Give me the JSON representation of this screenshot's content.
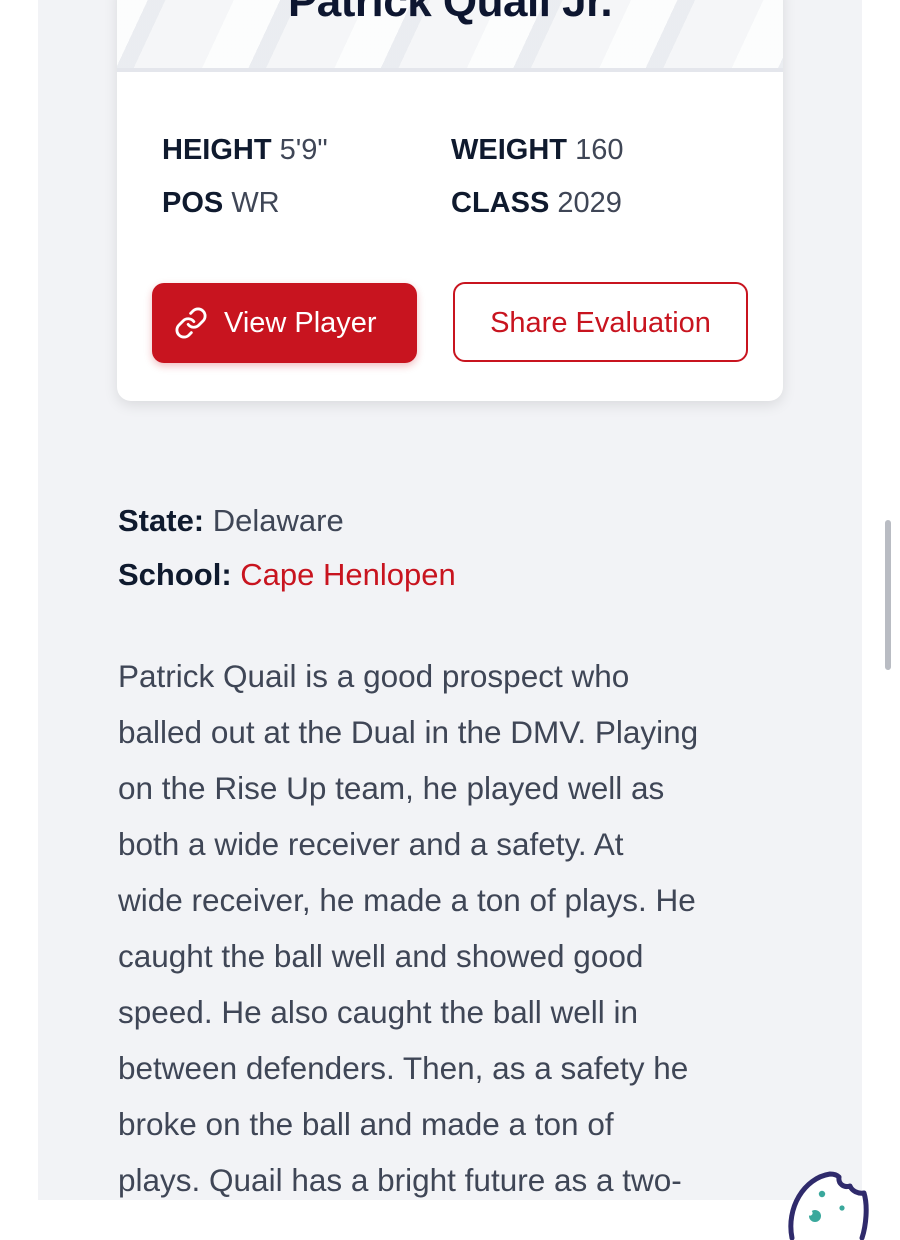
{
  "player": {
    "name": "Patrick Quail Jr.",
    "stats": {
      "height_label": "HEIGHT",
      "height_value": "5'9\"",
      "weight_label": "WEIGHT",
      "weight_value": "160",
      "pos_label": "POS",
      "pos_value": "WR",
      "class_label": "CLASS",
      "class_value": "2029"
    },
    "actions": {
      "view_label": "View Player",
      "view_icon": "link-icon",
      "share_label": "Share Evaluation"
    }
  },
  "info": {
    "state_label": "State:",
    "state_value": "Delaware",
    "school_label": "School:",
    "school_value": "Cape Henlopen"
  },
  "article": {
    "lines": [
      "Patrick Quail is a good prospect who",
      "balled out at the Dual in the DMV. Playing",
      "on the Rise Up team, he played well as",
      "both a wide receiver and a safety. At",
      "wide receiver, he made a ton of plays. He",
      "caught the ball well and showed good",
      "speed. He also caught the ball well in",
      "between defenders. Then, as a safety he",
      "broke on the ball and made a ton of",
      "plays. Quail has a bright future as a two-"
    ]
  },
  "colors": {
    "accent": "#c8141f",
    "page_background": "#f2f3f6",
    "heading_text": "#0f1a2e",
    "body_text": "#3f4656"
  },
  "widgets": {
    "cookie_icon": "cookie-icon"
  }
}
